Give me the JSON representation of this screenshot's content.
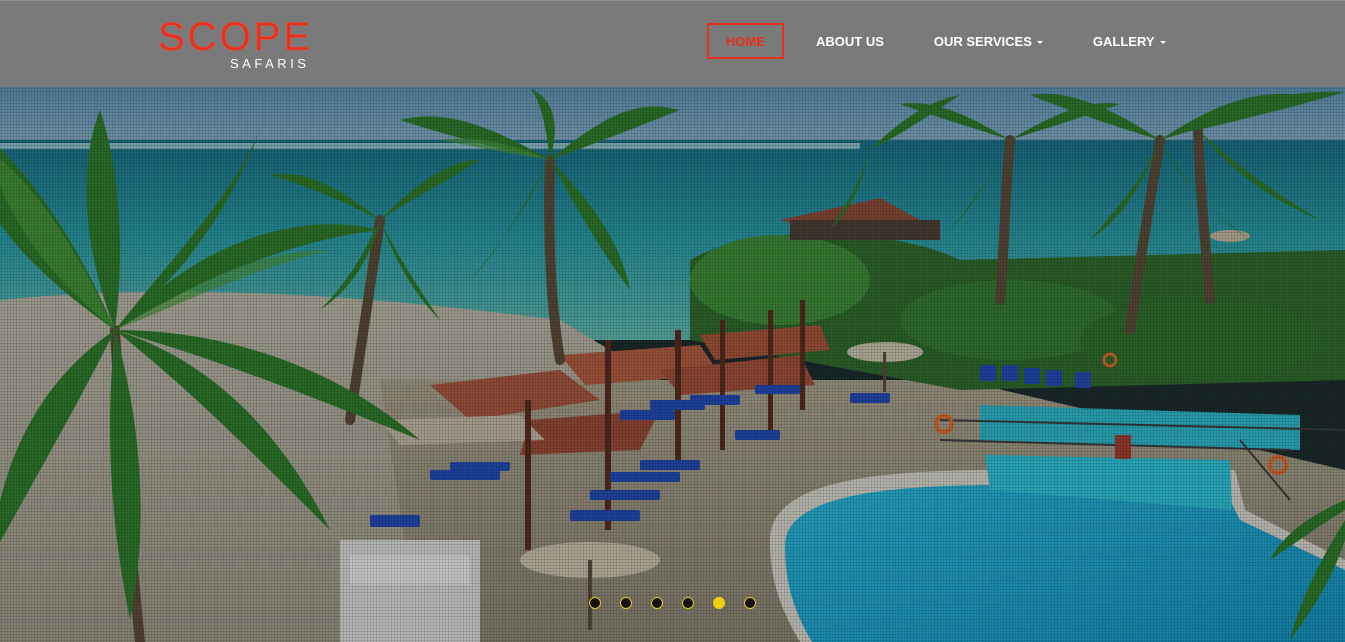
{
  "brand": {
    "name": "SCOPE",
    "tagline": "SAFARIS",
    "brand_color": "#e5301e"
  },
  "nav": {
    "items": [
      {
        "label": "HOME",
        "active": true
      },
      {
        "label": "ABOUT US",
        "active": false
      },
      {
        "label": "OUR SERVICES",
        "has_dropdown": true,
        "active": false
      },
      {
        "label": "GALLERY",
        "has_dropdown": true,
        "active": false
      }
    ],
    "header_bg": "#7a7a7a",
    "active_color": "#e5301e"
  },
  "carousel": {
    "slide_count": 6,
    "active_index": 4,
    "indicator_active_color": "#f1cf10"
  },
  "icons": {
    "dropdown": "caret-down-icon"
  }
}
